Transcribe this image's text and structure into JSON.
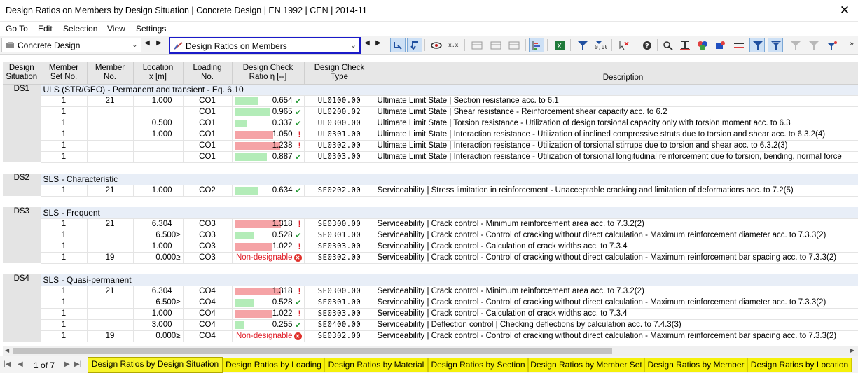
{
  "window": {
    "title": "Design Ratios on Members by Design Situation | Concrete Design | EN 1992 | CEN | 2014-11",
    "close": "✕"
  },
  "menu": [
    "Go To",
    "Edit",
    "Selection",
    "View",
    "Settings"
  ],
  "toolbar": {
    "module": "Concrete Design",
    "result": "Design Ratios on Members",
    "prev": "◀",
    "next": "▶"
  },
  "headers": {
    "ds": [
      "Design",
      "Situation"
    ],
    "set": [
      "Member",
      "Set No."
    ],
    "member": [
      "Member",
      "No."
    ],
    "location": [
      "Location",
      "x [m]"
    ],
    "loading": [
      "Loading",
      "No."
    ],
    "ratio": [
      "Design Check",
      "Ratio η [--]"
    ],
    "type": [
      "Design Check",
      "Type"
    ],
    "desc": "Description"
  },
  "situations": [
    {
      "id": "DS1",
      "title": "ULS (STR/GEO) - Permanent and transient - Eq. 6.10",
      "rows": [
        {
          "set": "1",
          "member": "21",
          "loc": "1.000",
          "mark": "",
          "load": "CO1",
          "ratio": "0.654",
          "value": 0.654,
          "ok": true,
          "type": "UL0100.00",
          "desc": "Ultimate Limit State | Section resistance acc. to 6.1"
        },
        {
          "set": "1",
          "member": "",
          "loc": "",
          "mark": "",
          "load": "CO1",
          "ratio": "0.965",
          "value": 0.965,
          "ok": true,
          "type": "UL0200.02",
          "desc": "Ultimate Limit State | Shear resistance - Reinforcement shear capacity acc. to 6.2"
        },
        {
          "set": "1",
          "member": "",
          "loc": "0.500",
          "mark": "",
          "load": "CO1",
          "ratio": "0.337",
          "value": 0.337,
          "ok": true,
          "type": "UL0300.00",
          "desc": "Ultimate Limit State | Torsion resistance - Utilization of design torsional capacity only with torsion moment acc. to 6.3"
        },
        {
          "set": "1",
          "member": "",
          "loc": "1.000",
          "mark": "",
          "load": "CO1",
          "ratio": "1.050",
          "value": 1.05,
          "ok": false,
          "type": "UL0301.00",
          "desc": "Ultimate Limit State | Interaction resistance - Utilization of inclined compressive struts due to torsion and shear acc. to 6.3.2(4)"
        },
        {
          "set": "1",
          "member": "",
          "loc": "",
          "mark": "",
          "load": "CO1",
          "ratio": "1.238",
          "value": 1.238,
          "ok": false,
          "type": "UL0302.00",
          "desc": "Ultimate Limit State | Interaction resistance - Utilization of torsional stirrups due to torsion and shear acc. to 6.3.2(3)"
        },
        {
          "set": "1",
          "member": "",
          "loc": "",
          "mark": "",
          "load": "CO1",
          "ratio": "0.887",
          "value": 0.887,
          "ok": true,
          "type": "UL0303.00",
          "desc": "Ultimate Limit State | Interaction resistance - Utilization of torsional longitudinal reinforcement due to torsion, bending, normal force"
        }
      ]
    },
    {
      "id": "DS2",
      "title": "SLS - Characteristic",
      "rows": [
        {
          "set": "1",
          "member": "21",
          "loc": "1.000",
          "mark": "",
          "load": "CO2",
          "ratio": "0.634",
          "value": 0.634,
          "ok": true,
          "type": "SE0202.00",
          "desc": "Serviceability | Stress limitation in reinforcement - Unacceptable cracking and limitation of deformations acc. to 7.2(5)"
        }
      ]
    },
    {
      "id": "DS3",
      "title": "SLS - Frequent",
      "rows": [
        {
          "set": "1",
          "member": "21",
          "loc": "6.304",
          "mark": "",
          "load": "CO3",
          "ratio": "1.318",
          "value": 1.318,
          "ok": false,
          "type": "SE0300.00",
          "desc": "Serviceability | Crack control - Minimum reinforcement area acc. to 7.3.2(2)"
        },
        {
          "set": "1",
          "member": "",
          "loc": "6.500",
          "mark": "≥",
          "load": "CO3",
          "ratio": "0.528",
          "value": 0.528,
          "ok": true,
          "type": "SE0301.00",
          "desc": "Serviceability | Crack control - Control of cracking without direct calculation - Maximum reinforcement diameter acc. to 7.3.3(2)"
        },
        {
          "set": "1",
          "member": "",
          "loc": "1.000",
          "mark": "",
          "load": "CO3",
          "ratio": "1.022",
          "value": 1.022,
          "ok": false,
          "type": "SE0303.00",
          "desc": "Serviceability | Crack control - Calculation of crack widths acc. to 7.3.4"
        },
        {
          "set": "1",
          "member": "19",
          "loc": "0.000",
          "mark": "≥",
          "load": "CO3",
          "ratio": "Non-designable",
          "value": null,
          "ok": null,
          "type": "SE0302.00",
          "desc": "Serviceability | Crack control - Control of cracking without direct calculation - Maximum reinforcement bar spacing acc. to 7.3.3(2)"
        }
      ]
    },
    {
      "id": "DS4",
      "title": "SLS - Quasi-permanent",
      "rows": [
        {
          "set": "1",
          "member": "21",
          "loc": "6.304",
          "mark": "",
          "load": "CO4",
          "ratio": "1.318",
          "value": 1.318,
          "ok": false,
          "type": "SE0300.00",
          "desc": "Serviceability | Crack control - Minimum reinforcement area acc. to 7.3.2(2)"
        },
        {
          "set": "1",
          "member": "",
          "loc": "6.500",
          "mark": "≥",
          "load": "CO4",
          "ratio": "0.528",
          "value": 0.528,
          "ok": true,
          "type": "SE0301.00",
          "desc": "Serviceability | Crack control - Control of cracking without direct calculation - Maximum reinforcement diameter acc. to 7.3.3(2)"
        },
        {
          "set": "1",
          "member": "",
          "loc": "1.000",
          "mark": "",
          "load": "CO4",
          "ratio": "1.022",
          "value": 1.022,
          "ok": false,
          "type": "SE0303.00",
          "desc": "Serviceability | Crack control - Calculation of crack widths acc. to 7.3.4"
        },
        {
          "set": "1",
          "member": "",
          "loc": "3.000",
          "mark": "",
          "load": "CO4",
          "ratio": "0.255",
          "value": 0.255,
          "ok": true,
          "type": "SE0400.00",
          "desc": "Serviceability | Deflection control | Checking deflections by calculation acc. to 7.4.3(3)"
        },
        {
          "set": "1",
          "member": "19",
          "loc": "0.000",
          "mark": "≥",
          "load": "CO4",
          "ratio": "Non-designable",
          "value": null,
          "ok": null,
          "type": "SE0302.00",
          "desc": "Serviceability | Crack control - Control of cracking without direct calculation - Maximum reinforcement bar spacing acc. to 7.3.3(2)"
        }
      ]
    }
  ],
  "pager": {
    "text": "1 of 7"
  },
  "tabs": [
    "Design Ratios by Design Situation",
    "Design Ratios by Loading",
    "Design Ratios by Material",
    "Design Ratios by Section",
    "Design Ratios by Member Set",
    "Design Ratios by Member",
    "Design Ratios by Location"
  ],
  "colors": {
    "ok_bar": "#b3ecb8",
    "fail_bar": "#f5a3a6",
    "tab": "#f5f10a",
    "highlight": "#1a1ac8"
  }
}
